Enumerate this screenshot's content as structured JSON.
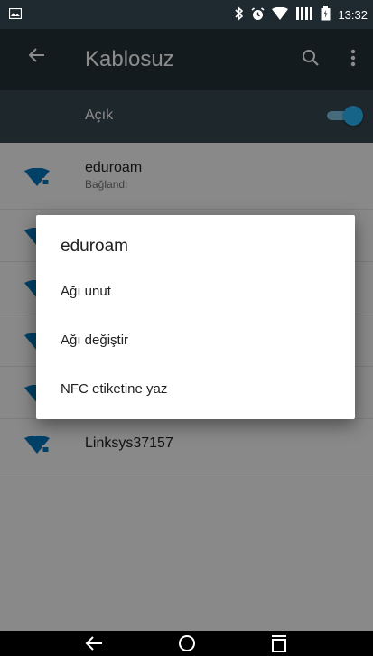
{
  "status_bar": {
    "time": "13:32",
    "icons": [
      "image-notification-icon",
      "bluetooth-icon",
      "alarm-icon",
      "wifi-signal-icon",
      "cell-signal-icon",
      "battery-icon"
    ]
  },
  "app_bar": {
    "title": "Kablosuz",
    "icons": [
      "back-arrow-icon",
      "search-icon",
      "more-vert-icon"
    ]
  },
  "wifi_switch": {
    "label": "Açık",
    "on": true,
    "accent": "#29b6f6"
  },
  "networks": [
    {
      "name": "eduroam",
      "status": "Bağlandı"
    },
    {
      "name": "",
      "status": ""
    },
    {
      "name": "",
      "status": ""
    },
    {
      "name": "",
      "status": ""
    },
    {
      "name": "",
      "status": ""
    },
    {
      "name": "Linksys37157",
      "status": ""
    }
  ],
  "dialog": {
    "title": "eduroam",
    "items": [
      {
        "label": "Ağı unut"
      },
      {
        "label": "Ağı değiştir"
      },
      {
        "label": "NFC etiketine yaz"
      }
    ]
  },
  "nav_bar": {
    "icons": [
      "nav-back-icon",
      "nav-home-icon",
      "nav-recents-icon"
    ]
  },
  "colors": {
    "app_bar": "#263238",
    "switch_bar": "#37474f",
    "wifi_icon": "#0277bd"
  }
}
